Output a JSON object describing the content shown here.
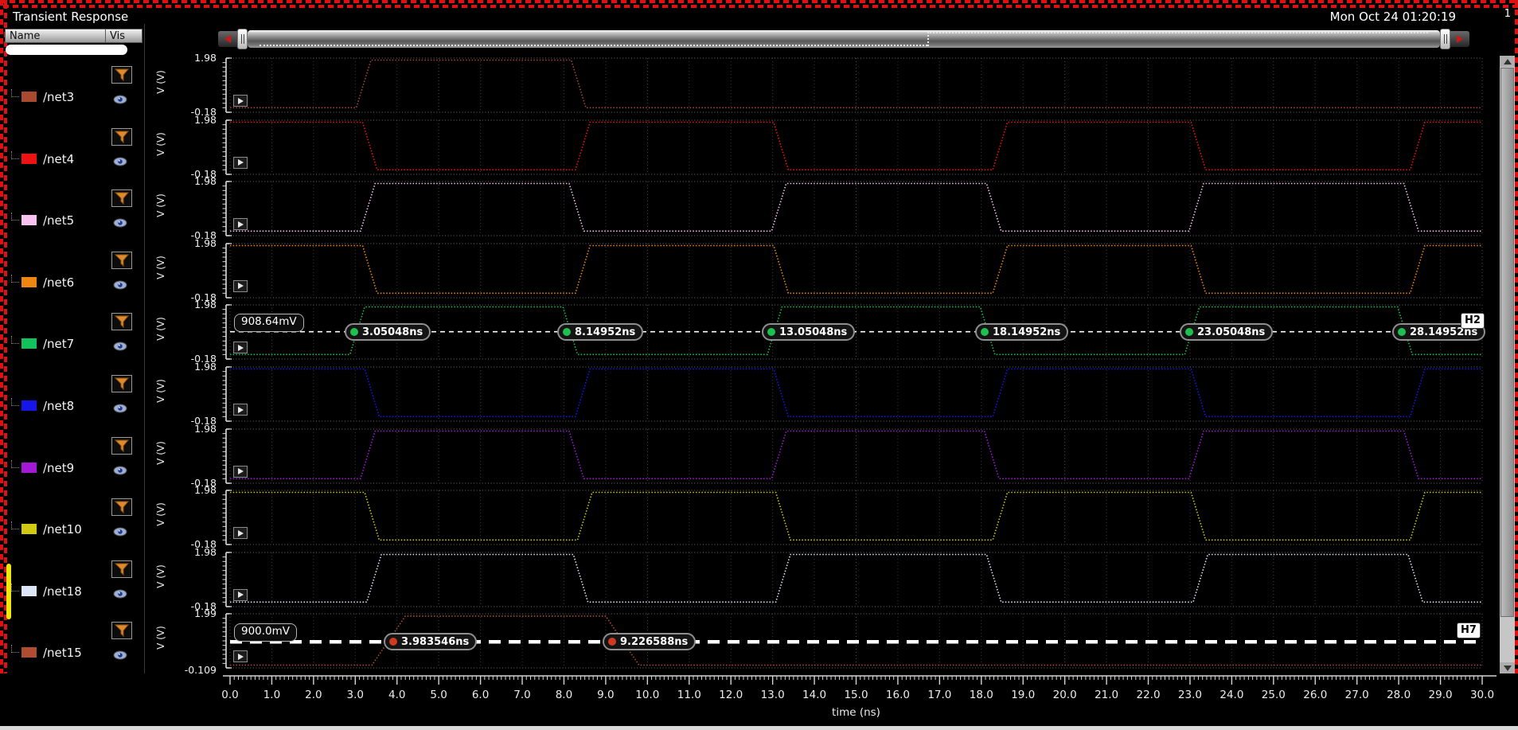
{
  "window": {
    "title": "Transient Response",
    "timestamp": "Mon Oct 24 01:20:19",
    "corner_char": "1"
  },
  "sidebar": {
    "name_header": "Name",
    "vis_header": "Vis",
    "filter_input_value": "",
    "icons": {
      "filter": "funnel-icon",
      "visibility": "eye-icon"
    },
    "nets": [
      {
        "name": "/net3",
        "color": "#a84a30",
        "selected": false
      },
      {
        "name": "/net4",
        "color": "#ee1212",
        "selected": false
      },
      {
        "name": "/net5",
        "color": "#f7c2ee",
        "selected": false
      },
      {
        "name": "/net6",
        "color": "#ef8512",
        "selected": false
      },
      {
        "name": "/net7",
        "color": "#12c25a",
        "selected": false
      },
      {
        "name": "/net8",
        "color": "#1616e8",
        "selected": false
      },
      {
        "name": "/net9",
        "color": "#a418d8",
        "selected": false
      },
      {
        "name": "/net10",
        "color": "#d2ca10",
        "selected": false
      },
      {
        "name": "/net18",
        "color": "#dce6f4",
        "selected": true
      },
      {
        "name": "/net15",
        "color": "#b04c32",
        "selected": false
      }
    ]
  },
  "chart_data": {
    "type": "line",
    "title": "Transient Response",
    "xlabel": "time (ns)",
    "xlim": [
      0,
      30
    ],
    "x_tick_labels": [
      "0.0",
      "1.0",
      "2.0",
      "3.0",
      "4.0",
      "5.0",
      "6.0",
      "7.0",
      "8.0",
      "9.0",
      "10.0",
      "11.0",
      "12.0",
      "13.0",
      "14.0",
      "15.0",
      "16.0",
      "17.0",
      "18.0",
      "19.0",
      "20.0",
      "21.0",
      "22.0",
      "23.0",
      "24.0",
      "25.0",
      "26.0",
      "27.0",
      "28.0",
      "29.0",
      "30.0"
    ],
    "grid": true,
    "legend_position": "left-panel",
    "strips": [
      {
        "net": "/net3",
        "color": "#a84a30",
        "ylabel": "V (V)",
        "ylim": [
          -0.18,
          1.98
        ],
        "y_tick_labels": [
          "1.98",
          "-0.18"
        ],
        "high_v": 1.9,
        "low_v": 0.0,
        "initial_level": "low",
        "toggle_times_ns": [
          3.2,
          8.35
        ],
        "edge_ns": 0.35
      },
      {
        "net": "/net4",
        "color": "#ee1212",
        "ylabel": "V (V)",
        "ylim": [
          -0.18,
          1.98
        ],
        "y_tick_labels": [
          "1.98",
          "-0.18"
        ],
        "high_v": 1.9,
        "low_v": 0.0,
        "initial_level": "high",
        "toggle_times_ns": [
          3.35,
          8.45,
          13.2,
          18.45,
          23.2,
          28.45
        ],
        "edge_ns": 0.35
      },
      {
        "net": "/net5",
        "color": "#f7c2ee",
        "ylabel": "V (V)",
        "ylim": [
          -0.18,
          1.98
        ],
        "y_tick_labels": [
          "1.98",
          "-0.18"
        ],
        "high_v": 1.9,
        "low_v": 0.0,
        "initial_level": "low",
        "toggle_times_ns": [
          3.3,
          8.3,
          13.15,
          18.3,
          23.15,
          28.3
        ],
        "edge_ns": 0.35
      },
      {
        "net": "/net6",
        "color": "#ef8512",
        "ylabel": "V (V)",
        "ylim": [
          -0.18,
          1.98
        ],
        "y_tick_labels": [
          "1.98",
          "-0.18"
        ],
        "high_v": 1.9,
        "low_v": 0.0,
        "initial_level": "high",
        "toggle_times_ns": [
          3.35,
          8.45,
          13.2,
          18.45,
          23.2,
          28.45
        ],
        "edge_ns": 0.35
      },
      {
        "net": "/net7",
        "color": "#12c25a",
        "ylabel": "V (V)",
        "ylim": [
          -0.18,
          1.98
        ],
        "y_tick_labels": [
          "1.98",
          "-0.18"
        ],
        "high_v": 1.9,
        "low_v": 0.0,
        "initial_level": "low",
        "toggle_times_ns": [
          3.05,
          8.15,
          13.05,
          18.15,
          23.05,
          28.15
        ],
        "edge_ns": 0.35,
        "marker_id": "H2"
      },
      {
        "net": "/net8",
        "color": "#1616e8",
        "ylabel": "V (V)",
        "ylim": [
          -0.18,
          1.98
        ],
        "y_tick_labels": [
          "1.98",
          "-0.18"
        ],
        "high_v": 1.9,
        "low_v": 0.0,
        "initial_level": "high",
        "toggle_times_ns": [
          3.4,
          8.45,
          13.2,
          18.45,
          23.2,
          28.45
        ],
        "edge_ns": 0.35
      },
      {
        "net": "/net9",
        "color": "#a418d8",
        "ylabel": "V (V)",
        "ylim": [
          -0.18,
          1.98
        ],
        "y_tick_labels": [
          "1.98",
          "-0.18"
        ],
        "high_v": 1.9,
        "low_v": 0.0,
        "initial_level": "low",
        "toggle_times_ns": [
          3.3,
          8.3,
          13.15,
          18.25,
          23.15,
          28.3
        ],
        "edge_ns": 0.35
      },
      {
        "net": "/net10",
        "color": "#d2ca10",
        "ylabel": "V (V)",
        "ylim": [
          -0.18,
          1.98
        ],
        "y_tick_labels": [
          "1.98",
          "-0.18"
        ],
        "high_v": 1.9,
        "low_v": 0.0,
        "initial_level": "high",
        "toggle_times_ns": [
          3.4,
          8.5,
          13.25,
          18.45,
          23.2,
          28.45
        ],
        "edge_ns": 0.35
      },
      {
        "net": "/net18",
        "color": "#dce6f4",
        "ylabel": "V (V)",
        "ylim": [
          -0.18,
          1.98
        ],
        "y_tick_labels": [
          "1.98",
          "-0.18"
        ],
        "high_v": 1.9,
        "low_v": 0.0,
        "initial_level": "low",
        "toggle_times_ns": [
          3.45,
          8.4,
          13.25,
          18.3,
          23.25,
          28.4
        ],
        "edge_ns": 0.35
      },
      {
        "net": "/net15",
        "color": "#b04c32",
        "ylabel": "V (V)",
        "ylim": [
          -0.109,
          1.99
        ],
        "y_tick_labels": [
          "1.99",
          "-0.109"
        ],
        "high_v": 1.9,
        "low_v": 0.0,
        "initial_level": "low",
        "toggle_times_ns": [
          3.8,
          9.4
        ],
        "edge_ns": 0.8,
        "marker_id": "H7"
      }
    ],
    "markers": [
      {
        "id": "H2",
        "strip_net": "/net7",
        "badge": "H2",
        "level_label": "908.64mV",
        "level_mV": 908.64,
        "dot_color": "#1ec050",
        "line_style": "thin-dashed",
        "points_ns": [
          3.05048,
          8.14952,
          13.05048,
          18.14952,
          23.05048,
          28.14952
        ],
        "point_labels": [
          "3.05048ns",
          "8.14952ns",
          "13.05048ns",
          "18.14952ns",
          "23.05048ns",
          "28.14952ns"
        ]
      },
      {
        "id": "H7",
        "strip_net": "/net15",
        "badge": "H7",
        "level_label": "900.0mV",
        "level_mV": 900.0,
        "dot_color": "#cf3a20",
        "line_style": "thick-dashed",
        "points_ns": [
          3.983546,
          9.226588
        ],
        "point_labels": [
          "3.983546ns",
          "9.226588ns"
        ]
      }
    ]
  }
}
